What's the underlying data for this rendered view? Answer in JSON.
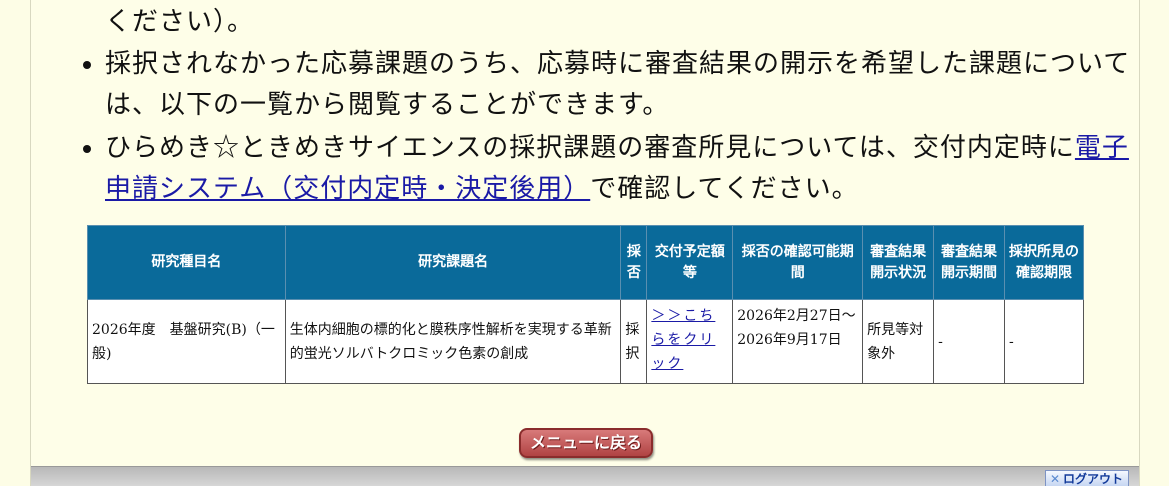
{
  "notice": {
    "continuation": "ください）。",
    "items": [
      {
        "text": "採択されなかった応募課題のうち、応募時に審査結果の開示を希望した課題については、以下の一覧から閲覧することができます。"
      },
      {
        "text_before": "ひらめき☆ときめきサイエンスの採択課題の審査所見については、交付内定時に",
        "link_text": "電子申請システム（交付内定時・決定後用）",
        "text_after": "で確認してください。"
      }
    ]
  },
  "table": {
    "headers": [
      "研究種目名",
      "研究課題名",
      "採否",
      "交付予定額等",
      "採否の確認可能期間",
      "審査結果開示状況",
      "審査結果開示期間",
      "採択所見の確認期限"
    ],
    "rows": [
      {
        "category": "2026年度　基盤研究(B)（一般)",
        "title": "生体内細胞の標的化と膜秩序性解析を実現する革新的蛍光ソルバトクロミック色素の創成",
        "result": "採択",
        "amount_link": "＞＞こちらをクリック",
        "period": "2026年2月27日～2026年9月17日",
        "disclosure_status": "所見等対象外",
        "disclosure_period": "-",
        "opinion_deadline": "-"
      }
    ]
  },
  "buttons": {
    "menu": "メニューに戻る",
    "logout": "ログアウト"
  },
  "colors": {
    "page_bg": "#fefee8",
    "table_header_bg": "#0a6a9a",
    "link": "#1a1aa6",
    "menu_button": "#b04343"
  }
}
